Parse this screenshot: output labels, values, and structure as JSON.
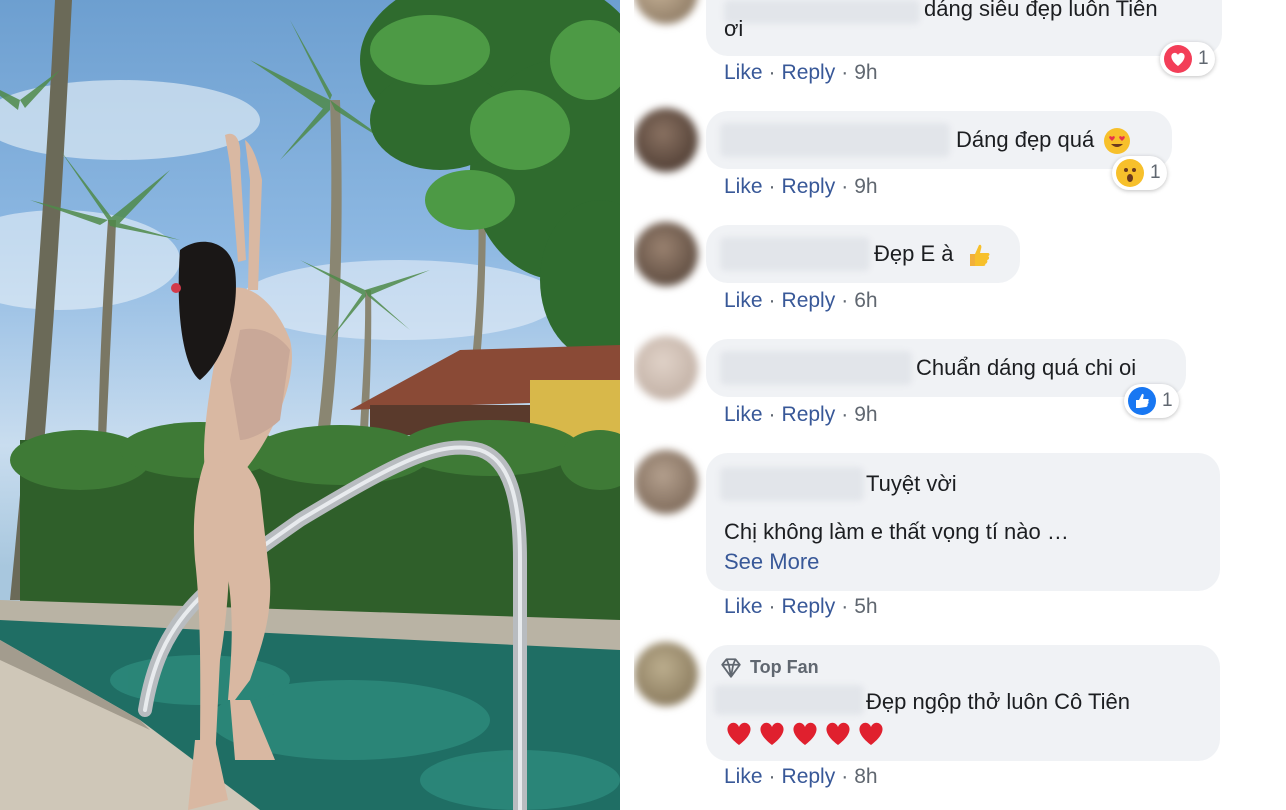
{
  "photo": {
    "description_icon": "pool-photo"
  },
  "actions": {
    "like": "Like",
    "reply": "Reply",
    "separator": "·"
  },
  "comments": [
    {
      "text_lines": [
        "dáng siêu đẹp luôn Tiên",
        "ơi"
      ],
      "time": "9h",
      "reaction": {
        "type": "heart-reaction-icon",
        "count": "1"
      }
    },
    {
      "text": "Dáng đẹp quá",
      "emoji": "heart-eyes-emoji-icon",
      "time": "9h",
      "reaction": {
        "type": "wow-reaction-icon",
        "count": "1"
      }
    },
    {
      "text": "Đẹp E à",
      "emoji": "thumbs-up-emoji-icon",
      "time": "6h"
    },
    {
      "text": "Chuẩn dáng quá chi oi",
      "time": "9h",
      "reaction": {
        "type": "like-reaction-icon",
        "count": "1"
      }
    },
    {
      "text": "Tuyệt vời",
      "text_line2": "Chị không làm e thất vọng tí nào …",
      "see_more": "See More",
      "time": "5h"
    },
    {
      "badge": "Top Fan",
      "text": "Đẹp ngộp thở luôn Cô Tiên",
      "emoji": "red-heart-emoji-icon",
      "emoji_count": 5,
      "time": "8h"
    }
  ],
  "colors": {
    "link": "#385898",
    "bubble": "#f0f2f5",
    "meta": "#606770"
  }
}
